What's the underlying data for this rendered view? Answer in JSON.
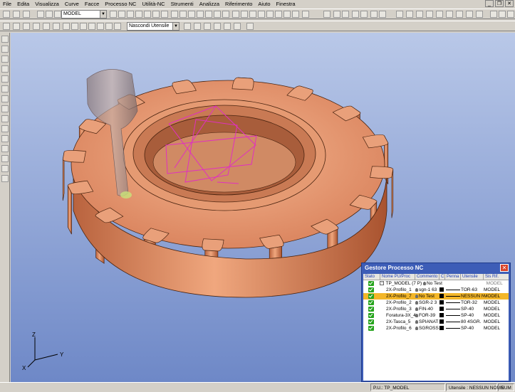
{
  "menu": [
    "File",
    "Edita",
    "Visualizza",
    "Curve",
    "Facce",
    "Processo NC",
    "Utilità-NC",
    "Strumenti",
    "Analizza",
    "Riferimento",
    "Aiuto",
    "Finestra"
  ],
  "toolbar": {
    "model_select": "MODEL",
    "tool_filter_select": "Nascondi Utensile"
  },
  "axes": {
    "z": "Z",
    "y": "Y",
    "x": "X"
  },
  "nc_panel": {
    "title": "Gestore Processo NC",
    "columns": [
      "Stato",
      "Nome PU/Proc",
      "Commento",
      "C",
      "Penna",
      "Utensile",
      "Sis Rif."
    ],
    "root": {
      "name": "TP_MODEL (7 P)",
      "comment": "No Test",
      "sis": "MODEL"
    },
    "rows": [
      {
        "name": "2X-Profilo_1",
        "comment": "sgn-1 63",
        "tool": "TOR-63",
        "sis": "MODEL",
        "selected": false
      },
      {
        "name": "2X-Profilo_7",
        "comment": "No Test",
        "tool": "NESSUN N",
        "sis": "MODEL",
        "selected": true
      },
      {
        "name": "2X-Profilo_2",
        "comment": "SGR-2 3",
        "tool": "TOR-32",
        "sis": "MODEL",
        "selected": false
      },
      {
        "name": "2X-Profilo_3",
        "comment": "FIN-40",
        "tool": "SP-40",
        "sis": "MODEL",
        "selected": false
      },
      {
        "name": "Foratura-3X_4",
        "comment": "FOR-39",
        "tool": "SP-40",
        "sis": "MODEL",
        "selected": false
      },
      {
        "name": "2X-Tasca_5",
        "comment": "SPIANAT",
        "tool": "80 4SGR.",
        "sis": "MODEL",
        "selected": false
      },
      {
        "name": "2X-Profilo_6",
        "comment": "SGROSS",
        "tool": "SP-40",
        "sis": "MODEL",
        "selected": false
      }
    ]
  },
  "status": {
    "pu": "P.U.: TP_MODEL",
    "utensile": "Utensile : NESSUN NOME",
    "num": "NUM"
  },
  "colors": {
    "gear": "#d9825c",
    "toolpath": "#e030c0",
    "bg_top": "#b9c8e8",
    "bg_bottom": "#6e88c7"
  }
}
